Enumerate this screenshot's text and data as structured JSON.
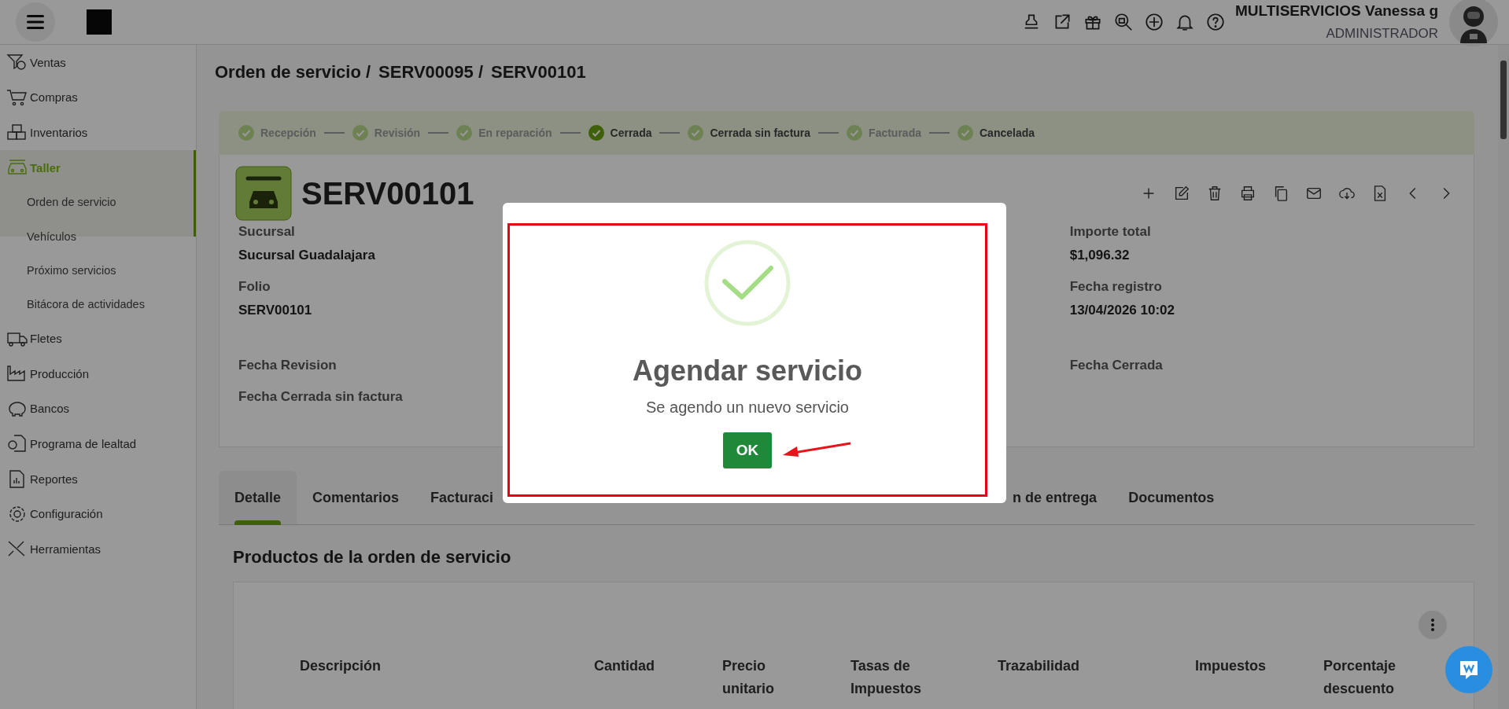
{
  "breadcrumb": [
    "Orden de servicio /",
    "SERV00095 /",
    "SERV00101"
  ],
  "user": {
    "name": "MULTISERVICIOS Vanessa g",
    "role": "ADMINISTRADOR"
  },
  "sidebar": {
    "items": [
      {
        "label": "Ventas",
        "selected": false
      },
      {
        "label": "Compras",
        "selected": false
      },
      {
        "label": "Inventarios",
        "selected": false
      },
      {
        "label": "Taller",
        "selected": true,
        "expanded": true,
        "children": [
          {
            "label": "Orden de servicio",
            "selected": true
          },
          {
            "label": "Vehículos",
            "selected": false
          },
          {
            "label": "Próximo servicios",
            "selected": false
          },
          {
            "label": "Bitácora de actividades",
            "selected": false
          }
        ]
      },
      {
        "label": "Fletes",
        "selected": false
      },
      {
        "label": "Producción",
        "selected": false
      },
      {
        "label": "Bancos",
        "selected": false
      },
      {
        "label": "Programa de lealtad",
        "selected": false
      },
      {
        "label": "Reportes",
        "selected": false
      },
      {
        "label": "Configuración",
        "selected": false
      },
      {
        "label": "Herramientas",
        "selected": false
      }
    ]
  },
  "stepper": [
    {
      "label": "Recepción",
      "selected": false,
      "available": false
    },
    {
      "label": "Revisión",
      "selected": false,
      "available": false
    },
    {
      "label": "En reparación",
      "selected": false,
      "available": false
    },
    {
      "label": "Cerrada",
      "selected": true,
      "available": true
    },
    {
      "label": "Cerrada sin factura",
      "selected": false,
      "available": true
    },
    {
      "label": "Facturada",
      "selected": false,
      "available": false
    },
    {
      "label": "Cancelada",
      "selected": false,
      "available": true
    }
  ],
  "order": {
    "title": "SERV00101",
    "left_fields": [
      {
        "label": "Sucursal",
        "value": "Sucursal Guadalajara"
      },
      {
        "label": "Folio",
        "value": "SERV00101"
      },
      {
        "label": "Fecha Revision"
      },
      {
        "label": "Fecha Cerrada sin factura"
      }
    ],
    "right_fields": [
      {
        "label": "Importe total",
        "value": "$1,096.32"
      },
      {
        "label": "Fecha registro",
        "value": "13/04/2026 10:02"
      },
      {
        "label": "Fecha Cerrada"
      }
    ]
  },
  "tabs": [
    {
      "label": "Detalle",
      "selected": true
    },
    {
      "label": "Comentarios",
      "selected": false
    },
    {
      "label": "Facturaci",
      "selected": false
    },
    {
      "label": "n de entrega",
      "selected": false
    },
    {
      "label": "Documentos",
      "selected": false
    }
  ],
  "products": {
    "title": "Productos de la orden de servicio",
    "columns": [
      "Descripción",
      "Cantidad",
      "Precio unitario",
      "Tasas de Impuestos",
      "Trazabilidad",
      "Impuestos",
      "Porcentaje descuento"
    ]
  },
  "dialog": {
    "title": "Agendar servicio",
    "message": "Se agendo un nuevo servicio",
    "button": "OK"
  }
}
